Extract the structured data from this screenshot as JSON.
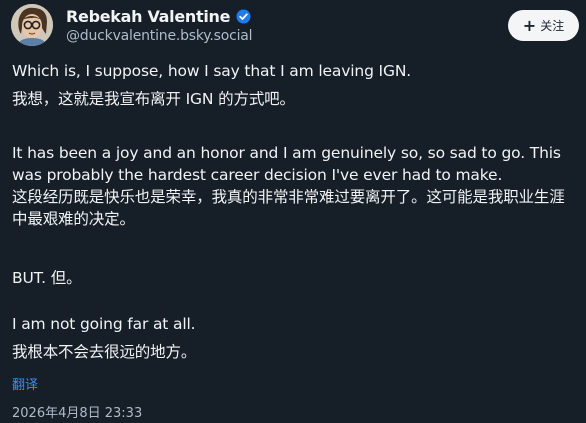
{
  "author": {
    "display_name": "Rebekah Valentine",
    "handle": "@duckvalentine.bsky.social",
    "verified_icon": "verified-check-icon",
    "avatar_icon": "avatar"
  },
  "follow_button": {
    "label": "关注",
    "icon": "plus-icon"
  },
  "post": {
    "paragraphs": [
      {
        "en": "Which is, I suppose, how I say that I am leaving IGN.",
        "zh": "我想，这就是我宣布离开 IGN 的方式吧。"
      },
      {
        "en": "It has been a joy and an honor and I am genuinely so, so sad to go. This was probably the hardest career decision I've ever had to make.",
        "zh": "这段经历既是快乐也是荣幸，我真的非常非常难过要离开了。这可能是我职业生涯中最艰难的决定。"
      },
      {
        "en": "BUT.",
        "zh": "但。"
      },
      {
        "en": "I am not going far at all.",
        "zh": "我根本不会去很远的地方。"
      }
    ],
    "translate_label": "翻译",
    "timestamp": "2026年4月8日 23:33"
  },
  "colors": {
    "background": "#161e27",
    "text": "#f1f3f5",
    "muted": "#aebbc9",
    "link": "#3e8fe8",
    "verified": "#1d7cf2",
    "button_bg": "#f4f5f7"
  }
}
